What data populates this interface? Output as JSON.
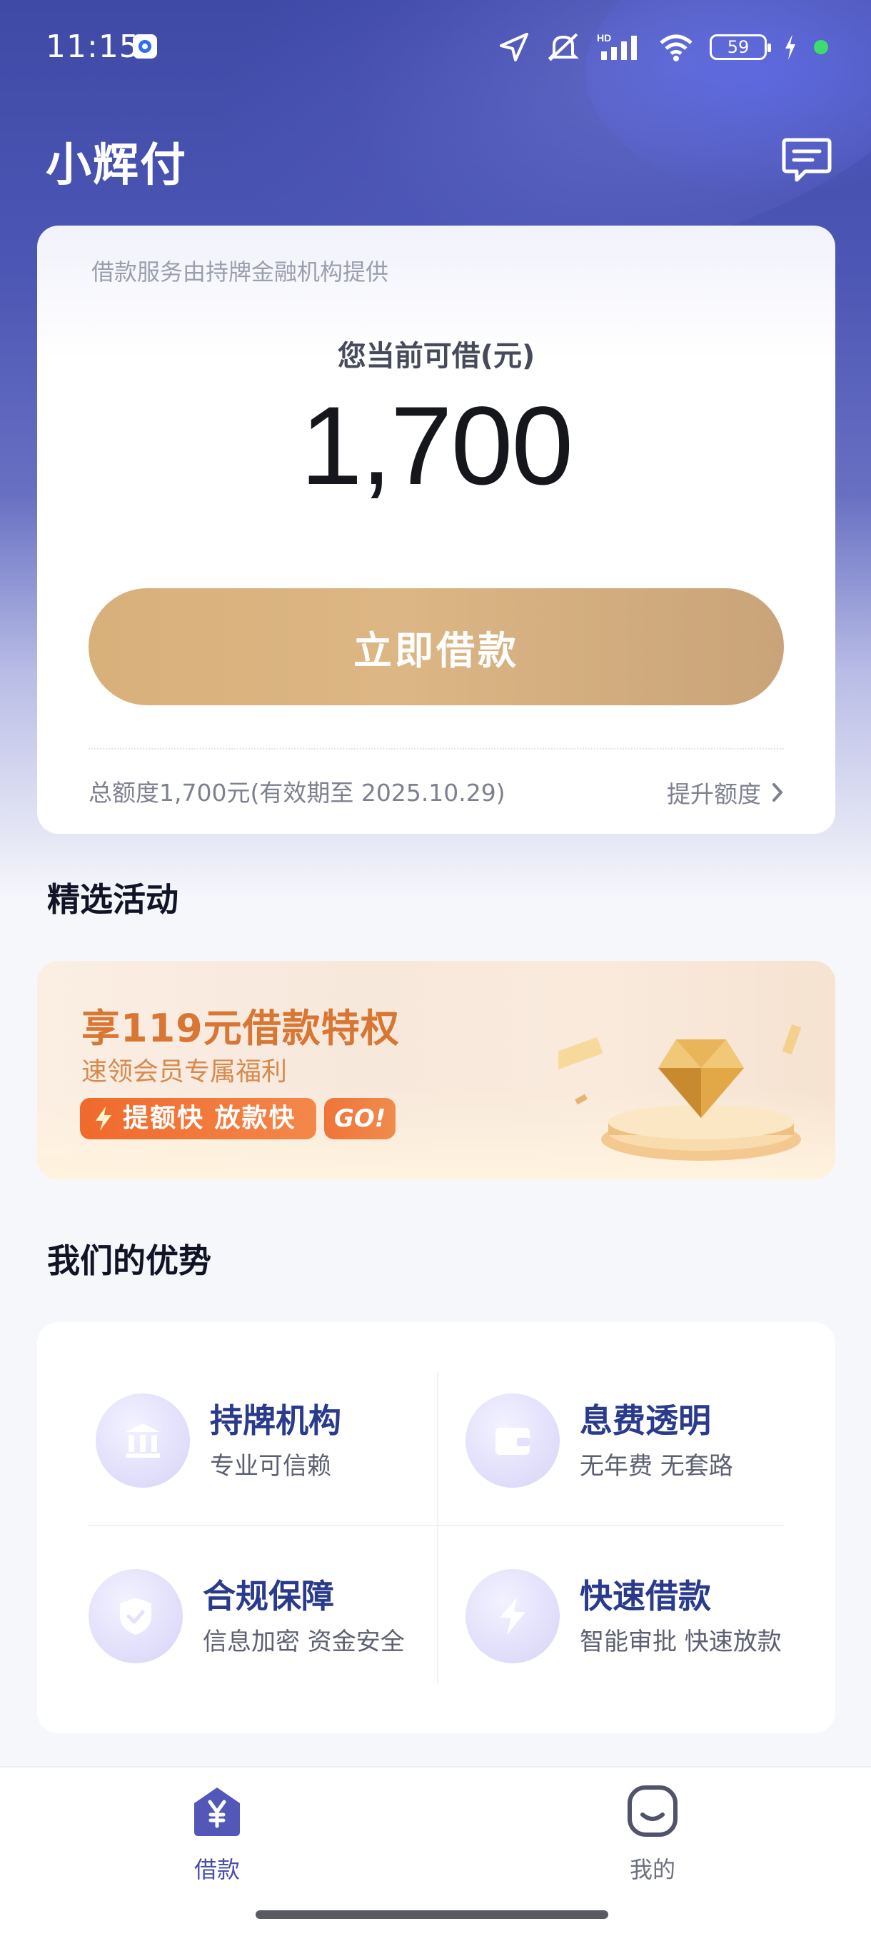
{
  "status_bar": {
    "time": "11:15",
    "battery": "59",
    "icons": [
      "location-icon",
      "mute-icon",
      "signal-hd-icon",
      "wifi-icon",
      "battery-icon",
      "charging-icon",
      "green-dot-icon"
    ]
  },
  "header": {
    "app_title": "小辉付",
    "message_icon": "message-icon"
  },
  "loan_card": {
    "notice": "借款服务由持牌金融机构提供",
    "available_label": "您当前可借(元)",
    "available_amount": "1,700",
    "borrow_button": "立即借款",
    "quota_text": "总额度1,700元(有效期至 2025.10.29)",
    "raise_link": "提升额度"
  },
  "activities": {
    "section_title": "精选活动",
    "banner": {
      "title": "享119元借款特权",
      "subtitle": "速领会员专属福利",
      "tag": "提额快 放款快",
      "go": "GO!"
    }
  },
  "advantages": {
    "section_title": "我们的优势",
    "items": [
      {
        "title": "持牌机构",
        "subtitle": "专业可信赖",
        "icon": "bank-icon"
      },
      {
        "title": "息费透明",
        "subtitle": "无年费 无套路",
        "icon": "wallet-icon"
      },
      {
        "title": "合规保障",
        "subtitle": "信息加密 资金安全",
        "icon": "shield-icon"
      },
      {
        "title": "快速借款",
        "subtitle": "智能审批 快速放款",
        "icon": "lightning-icon"
      }
    ]
  },
  "bottom_nav": {
    "items": [
      {
        "label": "借款",
        "icon": "yuan-home-icon",
        "active": true
      },
      {
        "label": "我的",
        "icon": "smile-face-icon",
        "active": false
      }
    ]
  },
  "colors": {
    "brand": "#4a4fa8",
    "button_gold": "#d8b07a",
    "promo_orange": "#d87634",
    "advantage_title": "#2a3a8c"
  }
}
